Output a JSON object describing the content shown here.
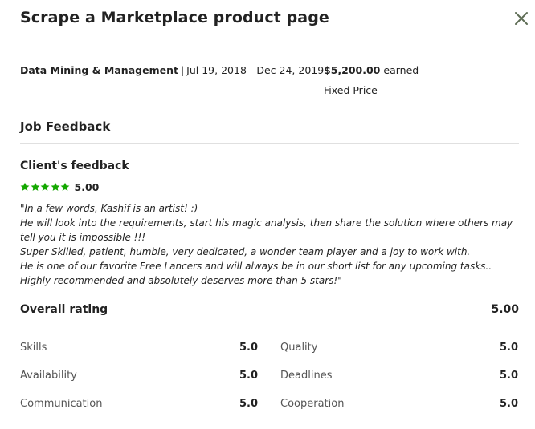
{
  "modal": {
    "title": "Scrape a Marketplace product page",
    "close_icon": "close-icon"
  },
  "job": {
    "category": "Data Mining & Management",
    "separator": "|",
    "dates": "Jul 19, 2018 - Dec 24, 2019",
    "amount": "$5,200.00",
    "earned_label": "earned",
    "price_type": "Fixed Price"
  },
  "feedback_section": {
    "title": "Job Feedback",
    "client_title": "Client's feedback",
    "stars_count": 5,
    "star_color": "#14a800",
    "score": "5.00",
    "lines": [
      "\"In a few words, Kashif is an artist! :)",
      "He will look into the requirements, start his magic analysis, then share the solution where others may",
      "tell you it is impossible !!!",
      "Super Skilled, patient, humble, very dedicated, a wonder team player and a joy to work with.",
      "He is one of our favorite Free Lancers and will always be in our short list for any upcoming tasks..",
      "Highly recommended and absolutely deserves more than 5 stars!\""
    ]
  },
  "overall": {
    "label": "Overall rating",
    "value": "5.00"
  },
  "metrics": [
    {
      "label": "Skills",
      "value": "5.0"
    },
    {
      "label": "Quality",
      "value": "5.0"
    },
    {
      "label": "Availability",
      "value": "5.0"
    },
    {
      "label": "Deadlines",
      "value": "5.0"
    },
    {
      "label": "Communication",
      "value": "5.0"
    },
    {
      "label": "Cooperation",
      "value": "5.0"
    }
  ]
}
